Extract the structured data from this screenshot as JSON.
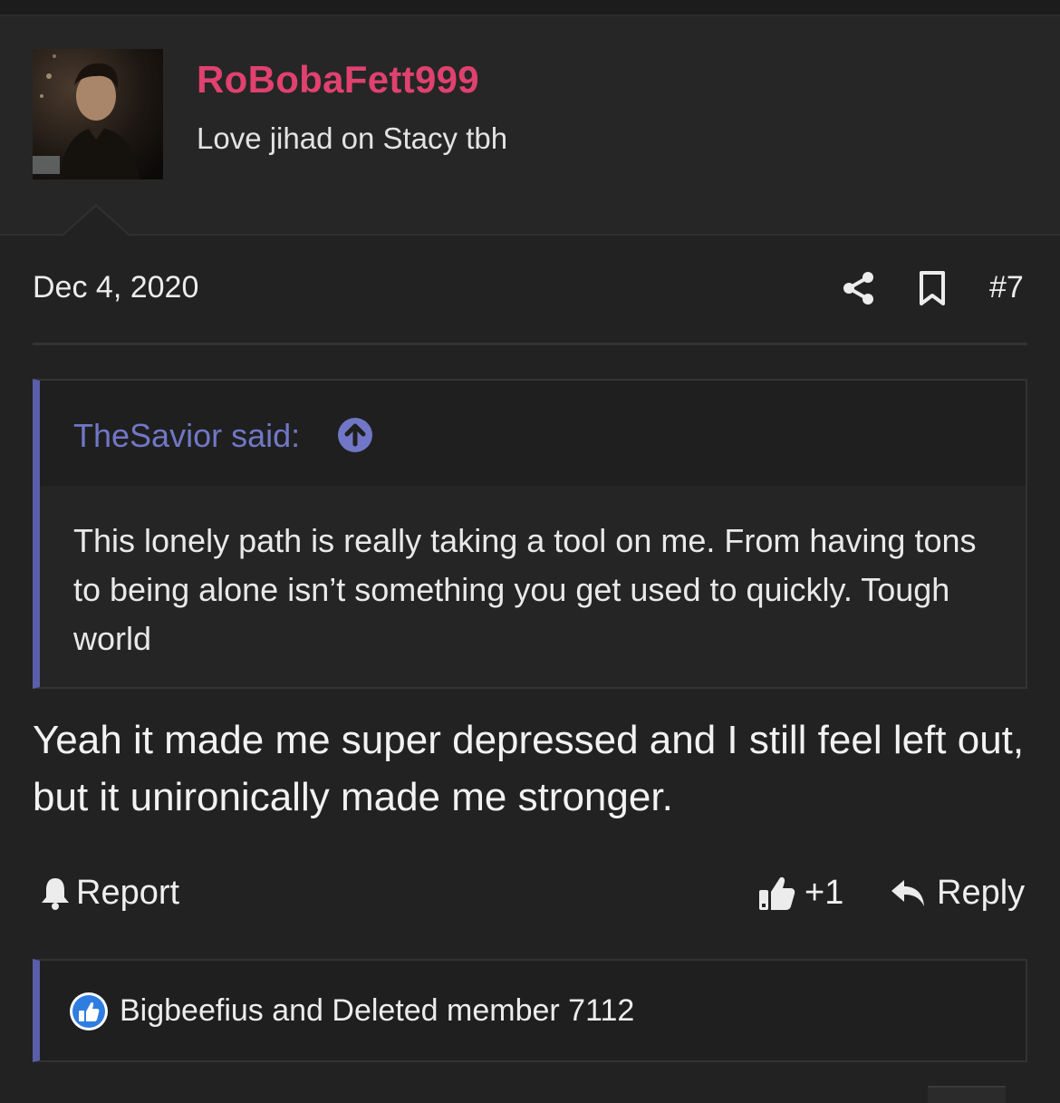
{
  "author": {
    "username": "RoBobaFett999",
    "user_title": "Love jihad on Stacy tbh"
  },
  "post": {
    "date": "Dec 4, 2020",
    "number": "#7",
    "body": "Yeah it made me super depressed and I still feel left out, but it unironically made me stronger."
  },
  "quote": {
    "author_line": "TheSavior said:",
    "text": "This lonely path is really taking a tool on me. From having tons to being alone isn’t something you get used to quickly. Tough world"
  },
  "actions": {
    "report_label": "Report",
    "like_count": "+1",
    "reply_label": "Reply"
  },
  "reactions": {
    "text": "Bigbeefius and Deleted member 7112"
  },
  "colors": {
    "background": "#222222",
    "username": "#e0416f",
    "quote_accent": "#5a5ea8",
    "quote_author": "#7177c6",
    "like_badge": "#2f7de1"
  },
  "icons": [
    "share-icon",
    "bookmark-icon",
    "arrow-up-circle-icon",
    "bell-icon",
    "thumbs-up-icon",
    "reply-arrow-icon",
    "like-badge-icon"
  ]
}
